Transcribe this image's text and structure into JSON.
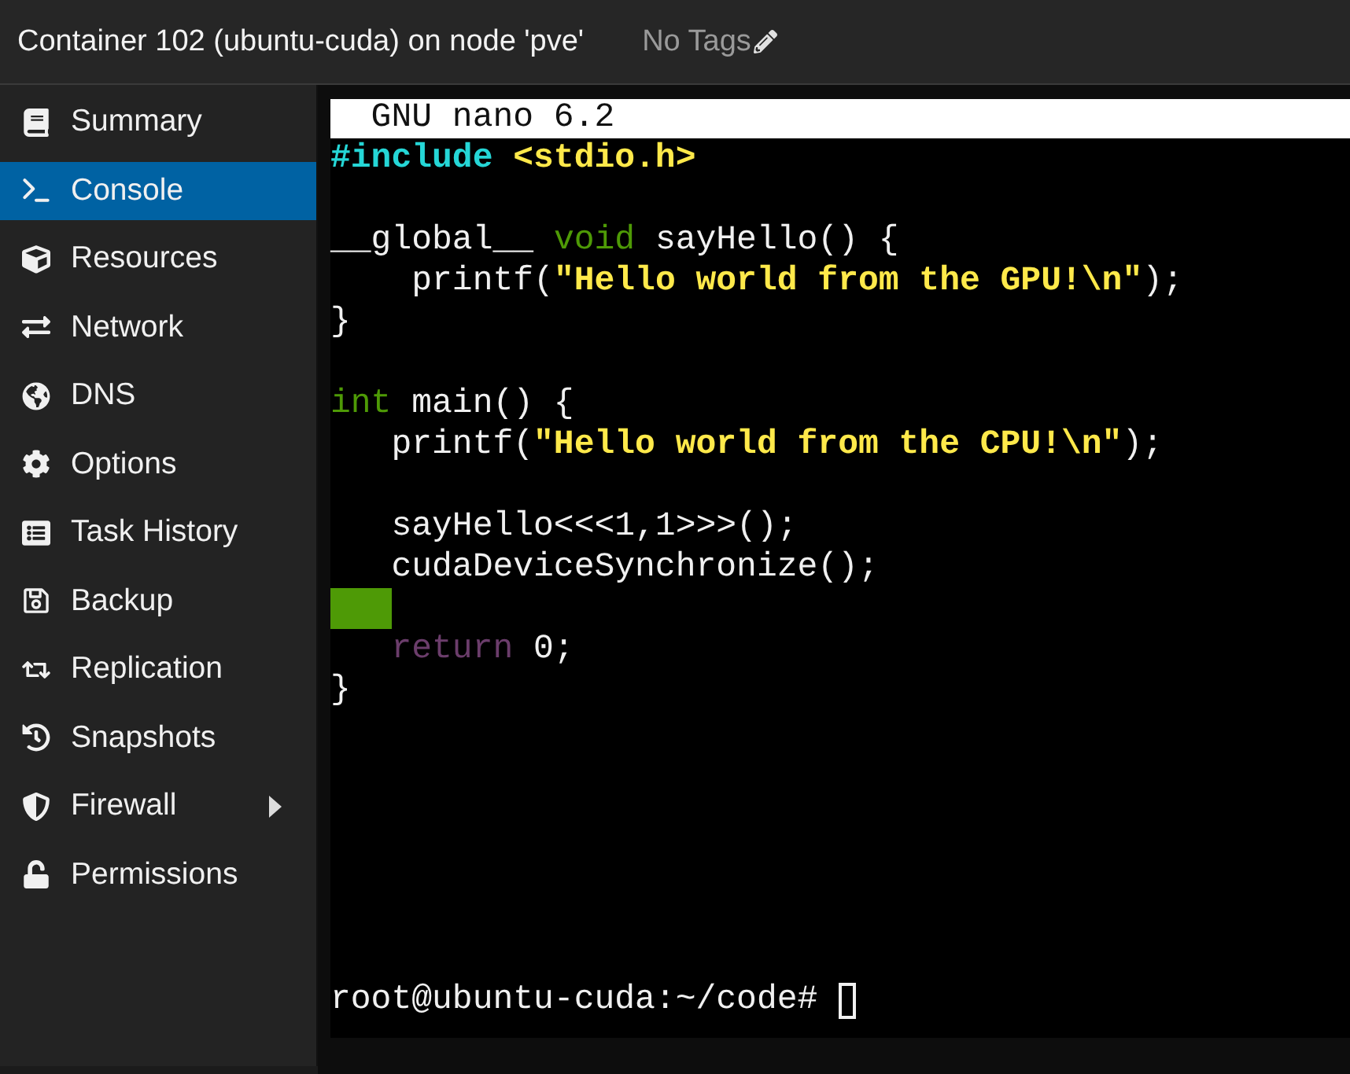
{
  "header": {
    "title": "Container 102 (ubuntu-cuda) on node 'pve'",
    "tags": "No Tags"
  },
  "sidebar": {
    "items": [
      {
        "label": "Summary",
        "selected": false,
        "expandable": false
      },
      {
        "label": "Console",
        "selected": true,
        "expandable": false
      },
      {
        "label": "Resources",
        "selected": false,
        "expandable": false
      },
      {
        "label": "Network",
        "selected": false,
        "expandable": false
      },
      {
        "label": "DNS",
        "selected": false,
        "expandable": false
      },
      {
        "label": "Options",
        "selected": false,
        "expandable": false
      },
      {
        "label": "Task History",
        "selected": false,
        "expandable": false
      },
      {
        "label": "Backup",
        "selected": false,
        "expandable": false
      },
      {
        "label": "Replication",
        "selected": false,
        "expandable": false
      },
      {
        "label": "Snapshots",
        "selected": false,
        "expandable": false
      },
      {
        "label": "Firewall",
        "selected": false,
        "expandable": true
      },
      {
        "label": "Permissions",
        "selected": false,
        "expandable": false
      }
    ]
  },
  "terminal": {
    "title_bar": "  GNU nano 6.2",
    "lines": [
      {
        "segments": [
          {
            "kind": "preproc",
            "text": "#include"
          },
          {
            "kind": "string",
            "text": " <stdio.h>"
          }
        ]
      },
      {
        "blank_before": true,
        "segments": [
          {
            "kind": "plain",
            "text": "__global__ "
          },
          {
            "kind": "type",
            "text": "void"
          },
          {
            "kind": "plain",
            "text": " sayHello() {"
          }
        ]
      },
      {
        "segments": [
          {
            "kind": "plain",
            "text": "    printf("
          },
          {
            "kind": "string",
            "text": "\"Hello world from the GPU!\\n\""
          },
          {
            "kind": "plain",
            "text": ");"
          }
        ]
      },
      {
        "segments": [
          {
            "kind": "plain",
            "text": "}"
          }
        ]
      },
      {
        "blank_before": true,
        "segments": [
          {
            "kind": "type",
            "text": "int"
          },
          {
            "kind": "plain",
            "text": " main() {"
          }
        ]
      },
      {
        "segments": [
          {
            "kind": "plain",
            "text": "   printf("
          },
          {
            "kind": "string",
            "text": "\"Hello world from the CPU!\\n\""
          },
          {
            "kind": "plain",
            "text": ");"
          }
        ]
      },
      {
        "blank_before": true,
        "segments": [
          {
            "kind": "plain",
            "text": "   sayHello<<<1,1>>>();"
          }
        ]
      },
      {
        "segments": [
          {
            "kind": "plain",
            "text": "   cudaDeviceSynchronize();"
          }
        ]
      },
      {
        "trailing_whitespace": true
      },
      {
        "segments": [
          {
            "kind": "keyword",
            "text": "   return"
          },
          {
            "kind": "plain",
            "text": " 0;"
          }
        ]
      },
      {
        "segments": [
          {
            "kind": "plain",
            "text": "}"
          }
        ]
      }
    ],
    "prompt": "root@ubuntu-cuda:~/code#"
  }
}
